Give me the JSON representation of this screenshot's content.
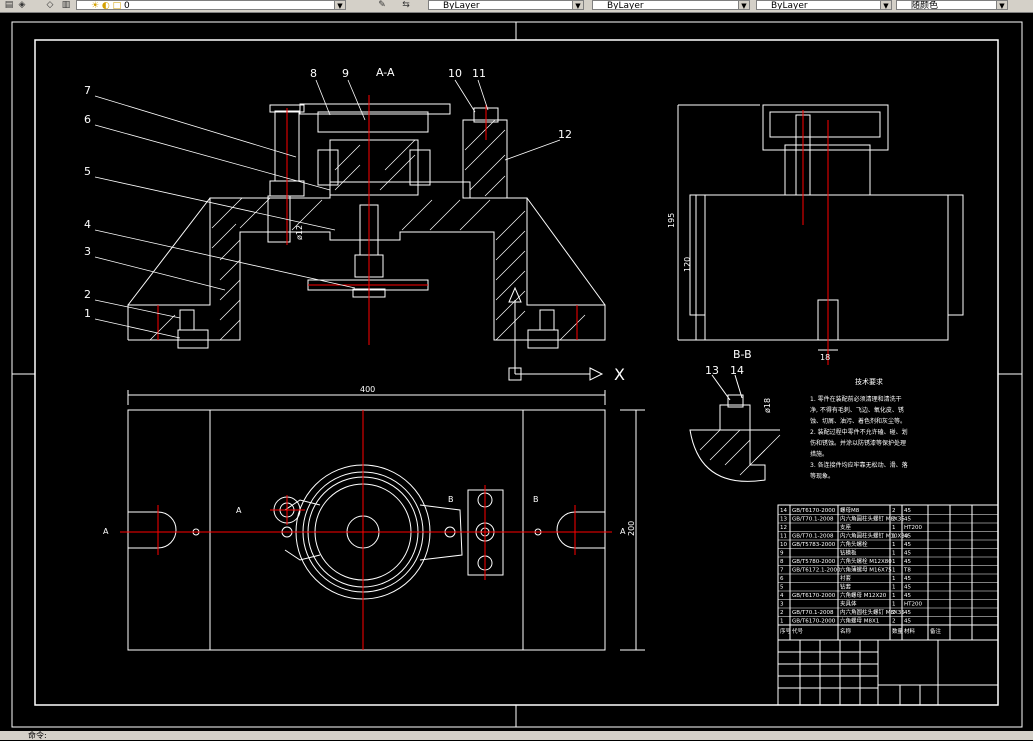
{
  "toolbar": {
    "layer_value": "0",
    "color_value": "ByLayer",
    "linetype_value": "ByLayer",
    "lineweight_value": "ByLayer",
    "plotstyle_value": "随颜色"
  },
  "drawing": {
    "section_aa": "A-A",
    "section_bb": "B-B",
    "axis_x": "X",
    "part_numbers": [
      "1",
      "2",
      "3",
      "4",
      "5",
      "6",
      "7",
      "8",
      "9",
      "10",
      "11",
      "12",
      "13",
      "14"
    ],
    "dim_width": "400",
    "dim_height": "200",
    "dim_right_total": "195",
    "dim_right_inner": "120",
    "dim_bottom_slot": "18",
    "dim_hole_12": "ø12",
    "dim_hole_18": "ø18",
    "plan_marks": [
      "A",
      "A",
      "A",
      "B",
      "B"
    ],
    "notes_title": "技术要求",
    "notes_lines": [
      "1. 零件在装配前必须清理和清洗干",
      "净, 不得有毛刺、飞边、氧化皮、锈",
      "蚀、切屑、油污、着色剂和灰尘等。",
      "2. 装配过程中零件不允许磕、碰、划",
      "伤和锈蚀。并涂以防锈漆等保护处理",
      "措施。",
      "3. 各连接件均应牢靠无松动、滑、落",
      "等现象。"
    ]
  },
  "title_block": {
    "rows": [
      [
        "14",
        "GB/T6170-2000",
        "螺母M8",
        "2",
        "45",
        ""
      ],
      [
        "13",
        "GB/T70.1-2008",
        "内六角圆柱头螺钉 M8X35",
        "2",
        "45",
        ""
      ],
      [
        "12",
        "",
        "支座",
        "1",
        "HT200",
        ""
      ],
      [
        "11",
        "GB/T70.1-2008",
        "内六角圆柱头螺钉 M10X30",
        "1",
        "45",
        ""
      ],
      [
        "10",
        "GB/T5783-2000",
        "六角头螺栓",
        "1",
        "45",
        ""
      ],
      [
        "9",
        "",
        "钻模板",
        "1",
        "45",
        ""
      ],
      [
        "8",
        "GB/T5780-2000",
        "六角头螺栓 M12X80",
        "1",
        "45",
        ""
      ],
      [
        "7",
        "GB/T6172.1-2000",
        "六角薄螺母 M16X75",
        "1",
        "T8",
        ""
      ],
      [
        "6",
        "",
        "衬套",
        "1",
        "45",
        ""
      ],
      [
        "5",
        "",
        "钻套",
        "1",
        "45",
        ""
      ],
      [
        "4",
        "GB/T6170-2000",
        "六角螺母 M12X20",
        "1",
        "45",
        ""
      ],
      [
        "3",
        "",
        "夹具体",
        "1",
        "HT200",
        ""
      ],
      [
        "2",
        "GB/T70.1-2008",
        "内六角圆柱头螺钉 M8X35",
        "2",
        "45",
        ""
      ],
      [
        "1",
        "GB/T6170-2000",
        "六角螺母 M8X1",
        "2",
        "45",
        ""
      ]
    ],
    "header": [
      "序号",
      "代号",
      "名称",
      "数量",
      "材料",
      "备注"
    ]
  },
  "status": {
    "text": "命令:"
  },
  "colors": {
    "background": "#000000",
    "lines": "#ffffff",
    "centerline": "#ff0000",
    "toolbar": "#d4d0c8"
  }
}
